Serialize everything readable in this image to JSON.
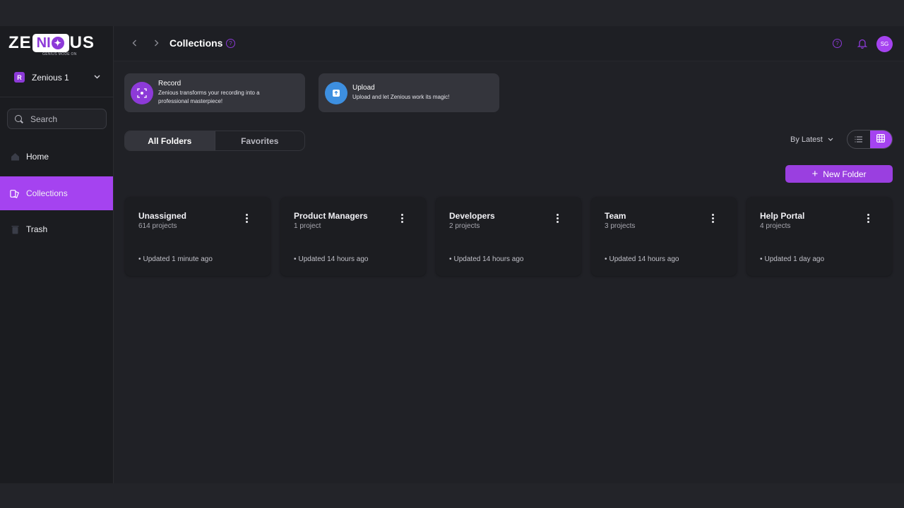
{
  "brand": {
    "logo_text_left": "ZE",
    "logo_text_badge": "NI",
    "logo_text_right": "US",
    "tagline": "GENIUS MODE ON"
  },
  "workspace": {
    "name": "Zenious 1",
    "icon_letter": "R"
  },
  "search": {
    "placeholder": "Search"
  },
  "sidebar": {
    "items": [
      {
        "label": "Home",
        "icon": "home-icon"
      },
      {
        "label": "Collections",
        "icon": "collections-icon",
        "active": true
      },
      {
        "label": "Trash",
        "icon": "trash-icon"
      }
    ]
  },
  "header": {
    "title": "Collections",
    "avatar_initials": "SG"
  },
  "actions": [
    {
      "title": "Record",
      "description_line1": "Zenious transforms your recording into a",
      "description_line2": "professional masterpiece!",
      "icon": "record-icon",
      "color": "#8d3ad8"
    },
    {
      "title": "Upload",
      "description_line1": "Upload and let Zenious work its magic!",
      "description_line2": "",
      "icon": "upload-icon",
      "color": "#3d8fe0"
    }
  ],
  "tabs": [
    {
      "label": "All Folders",
      "active": true
    },
    {
      "label": "Favorites",
      "active": false
    }
  ],
  "sort": {
    "label": "By Latest"
  },
  "new_folder": {
    "label": "New Folder"
  },
  "folders": [
    {
      "name": "Unassigned",
      "count": "614 projects",
      "updated": "Updated 1 minute ago"
    },
    {
      "name": "Product Managers",
      "count": "1 project",
      "updated": "Updated 14 hours ago"
    },
    {
      "name": "Developers",
      "count": "2 projects",
      "updated": "Updated 14 hours ago"
    },
    {
      "name": "Team",
      "count": "3 projects",
      "updated": "Updated 14 hours ago"
    },
    {
      "name": "Help Portal",
      "count": "4 projects",
      "updated": "Updated 1 day ago"
    }
  ],
  "colors": {
    "accent": "#a543f0",
    "sidebar_bg": "#1b1c20",
    "main_bg": "#202126",
    "card_bg": "#34353c"
  }
}
